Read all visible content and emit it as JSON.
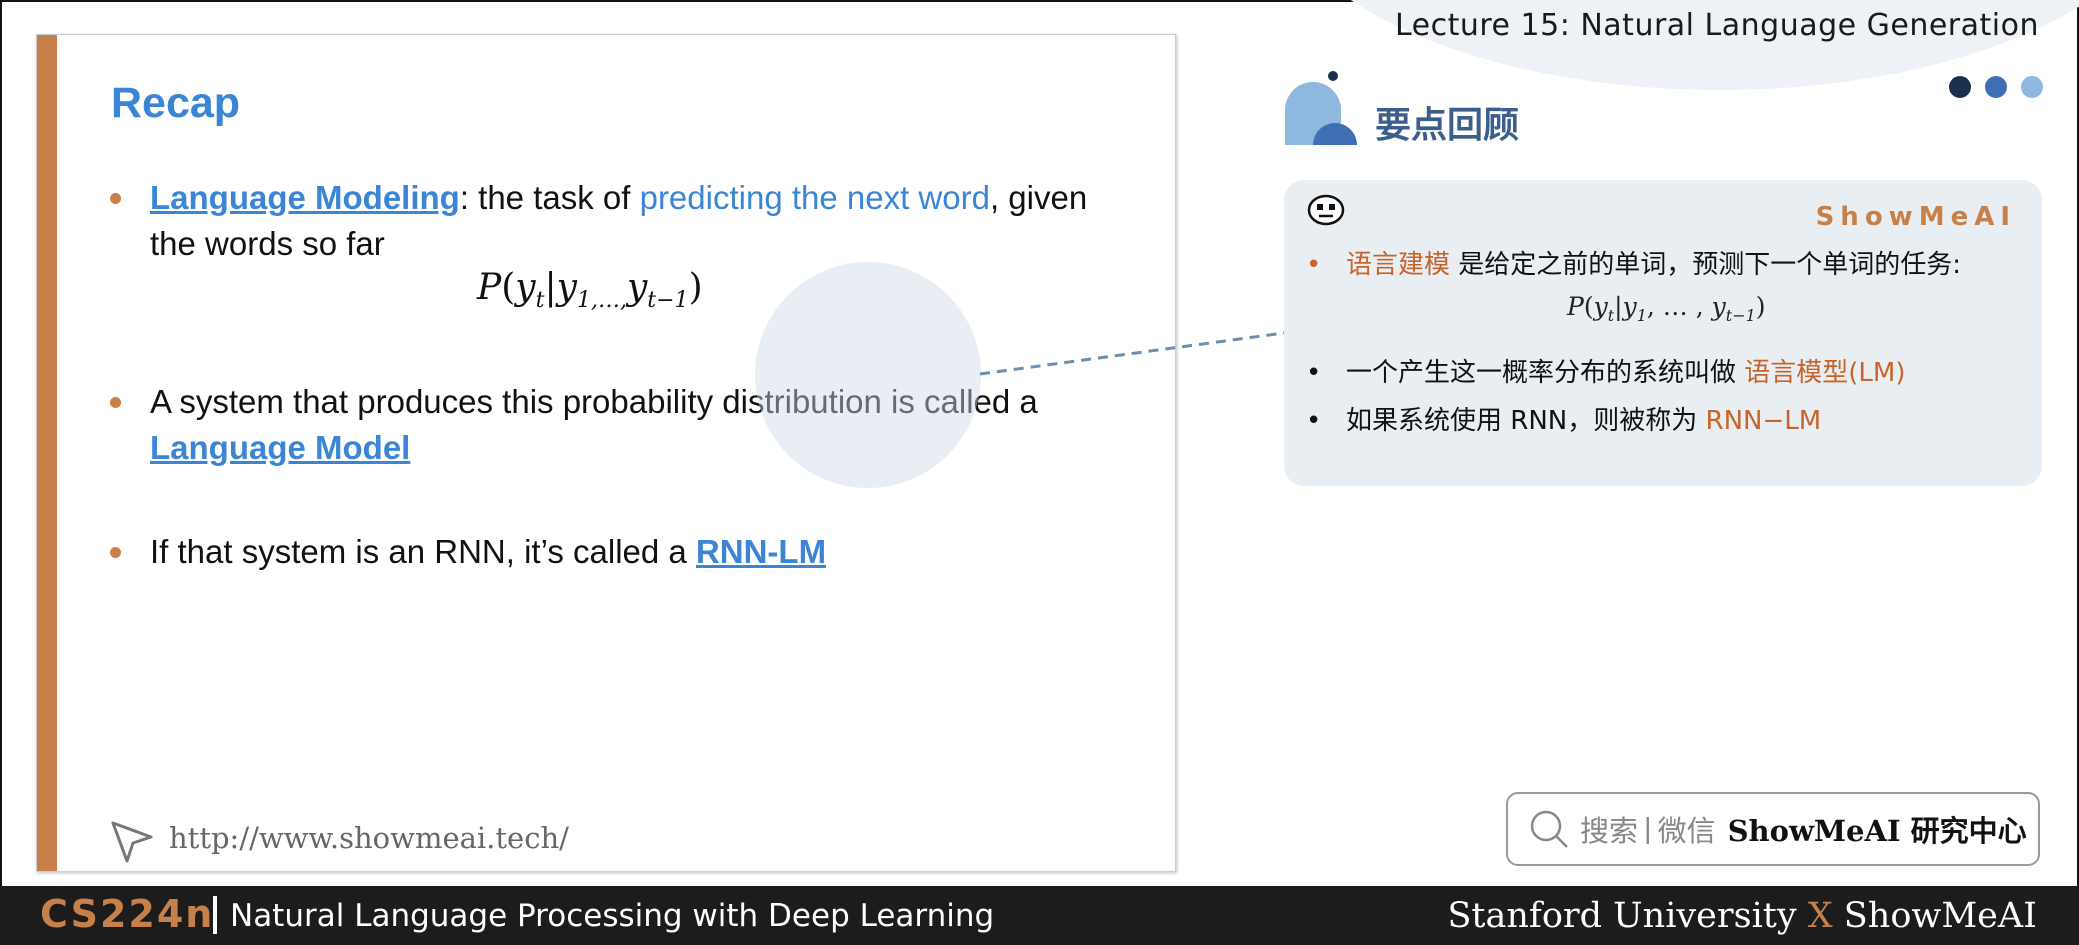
{
  "header": {
    "lecture_title": "Lecture 15: Natural Language Generation",
    "dot_colors": [
      "#1b2f4e",
      "#3f6fb5",
      "#8fb8de"
    ]
  },
  "slide": {
    "title": "Recap",
    "bullet1": {
      "link": "Language Modeling",
      "text_a": ": the task of ",
      "highlight": "predicting the next word",
      "text_b": ", given the words so far"
    },
    "formula": {
      "P": "P",
      "open": "(",
      "y": "y",
      "t": "t",
      "bar": "|",
      "y2": "y",
      "sub2": "1,…,",
      "y3": "y",
      "sub3": "t−1",
      "close": ")"
    },
    "bullet2": {
      "text": "A system that produces this probability distribution is called a ",
      "link": "Language Model"
    },
    "bullet3": {
      "text": "If that system is an RNN, it’s called a ",
      "link": "RNN-LM"
    },
    "footer_url": "http://www.showmeai.tech/"
  },
  "right_panel": {
    "section_title": "要点回顾",
    "brand": "ShowMeAI",
    "item1": {
      "highlight": "语言建模",
      "text": " 是给定之前的单词，预测下一个单词的任务:"
    },
    "formula": {
      "P": "P",
      "y": "y",
      "t": "t",
      "y2": "y",
      "sub2": "1",
      "mid": ", … , ",
      "y3": "y",
      "sub3": "t−1"
    },
    "item2": {
      "text": "一个产生这一概率分布的系统叫做 ",
      "highlight": "语言模型(LM)"
    },
    "item3": {
      "text": "如果系统使用 RNN，则被称为 ",
      "highlight": "RNN−LM"
    }
  },
  "search": {
    "label_a": "搜索",
    "sep": "|",
    "label_b": "微信",
    "brand": "ShowMeAI 研究中心"
  },
  "bottom_bar": {
    "course_code": "CS224n",
    "course_name": "Natural Language Processing with Deep Learning",
    "credit_a": "Stanford University ",
    "credit_x": "X",
    "credit_b": " ShowMeAI"
  },
  "colors": {
    "accent_orange": "#c8804a",
    "accent_blue": "#3a86d4",
    "panel_bg": "#e9eef2"
  }
}
